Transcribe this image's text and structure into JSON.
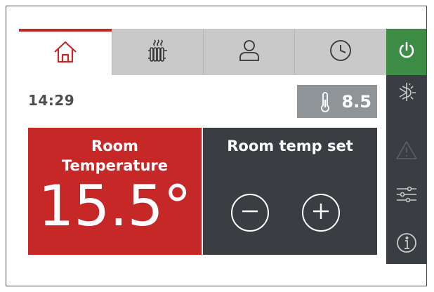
{
  "tabs": [
    {
      "name": "home",
      "icon": "home-icon",
      "active": true
    },
    {
      "name": "heating",
      "icon": "radiator-icon",
      "active": false
    },
    {
      "name": "user",
      "icon": "user-icon",
      "active": false
    },
    {
      "name": "schedule",
      "icon": "clock-icon",
      "active": false
    }
  ],
  "sidebar": {
    "items": [
      {
        "icon": "power-icon"
      },
      {
        "icon": "sun-snowflake-icon"
      },
      {
        "icon": "warning-icon"
      },
      {
        "icon": "sliders-icon"
      },
      {
        "icon": "info-icon"
      }
    ]
  },
  "status": {
    "time": "14:29",
    "outdoor_temp": "8.5"
  },
  "room": {
    "title": "Room Temperature",
    "value": "15.5°"
  },
  "setpoint": {
    "title": "Room temp set"
  },
  "colors": {
    "accent_red": "#c62828",
    "power_green": "#3d8c45",
    "dark_panel": "#3a3e42",
    "tab_inactive": "#c9c9c9"
  }
}
